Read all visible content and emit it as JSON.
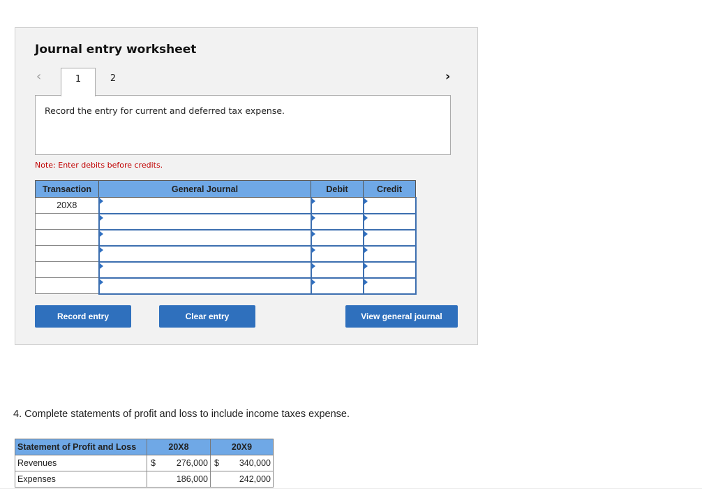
{
  "worksheet": {
    "title": "Journal entry worksheet",
    "tabs": [
      "1",
      "2"
    ],
    "active_tab": "1",
    "prev_icon": "chevron-left-icon",
    "next_icon": "chevron-right-icon",
    "prompt": "Record the entry for current and deferred tax expense.",
    "note": "Note: Enter debits before credits.",
    "table": {
      "headers": [
        "Transaction",
        "General Journal",
        "Debit",
        "Credit"
      ],
      "rows": [
        {
          "transaction": "20X8",
          "account": "",
          "debit": "",
          "credit": ""
        },
        {
          "transaction": "",
          "account": "",
          "debit": "",
          "credit": ""
        },
        {
          "transaction": "",
          "account": "",
          "debit": "",
          "credit": ""
        },
        {
          "transaction": "",
          "account": "",
          "debit": "",
          "credit": ""
        },
        {
          "transaction": "",
          "account": "",
          "debit": "",
          "credit": ""
        },
        {
          "transaction": "",
          "account": "",
          "debit": "",
          "credit": ""
        }
      ]
    },
    "buttons": {
      "record": "Record entry",
      "clear": "Clear entry",
      "view": "View general journal"
    }
  },
  "question": "4. Complete statements of profit and loss to include income taxes expense.",
  "pl_table": {
    "headers": [
      "Statement of Profit and Loss",
      "20X8",
      "20X9"
    ],
    "rows": [
      {
        "label": "Revenues",
        "cur1": "$",
        "v1": "276,000",
        "cur2": "$",
        "v2": "340,000"
      },
      {
        "label": "Expenses",
        "cur1": "",
        "v1": "186,000",
        "cur2": "",
        "v2": "242,000"
      }
    ]
  },
  "colors": {
    "header_blue": "#6fa8e6",
    "button_blue": "#2f70bd",
    "note_red": "#c00000"
  }
}
